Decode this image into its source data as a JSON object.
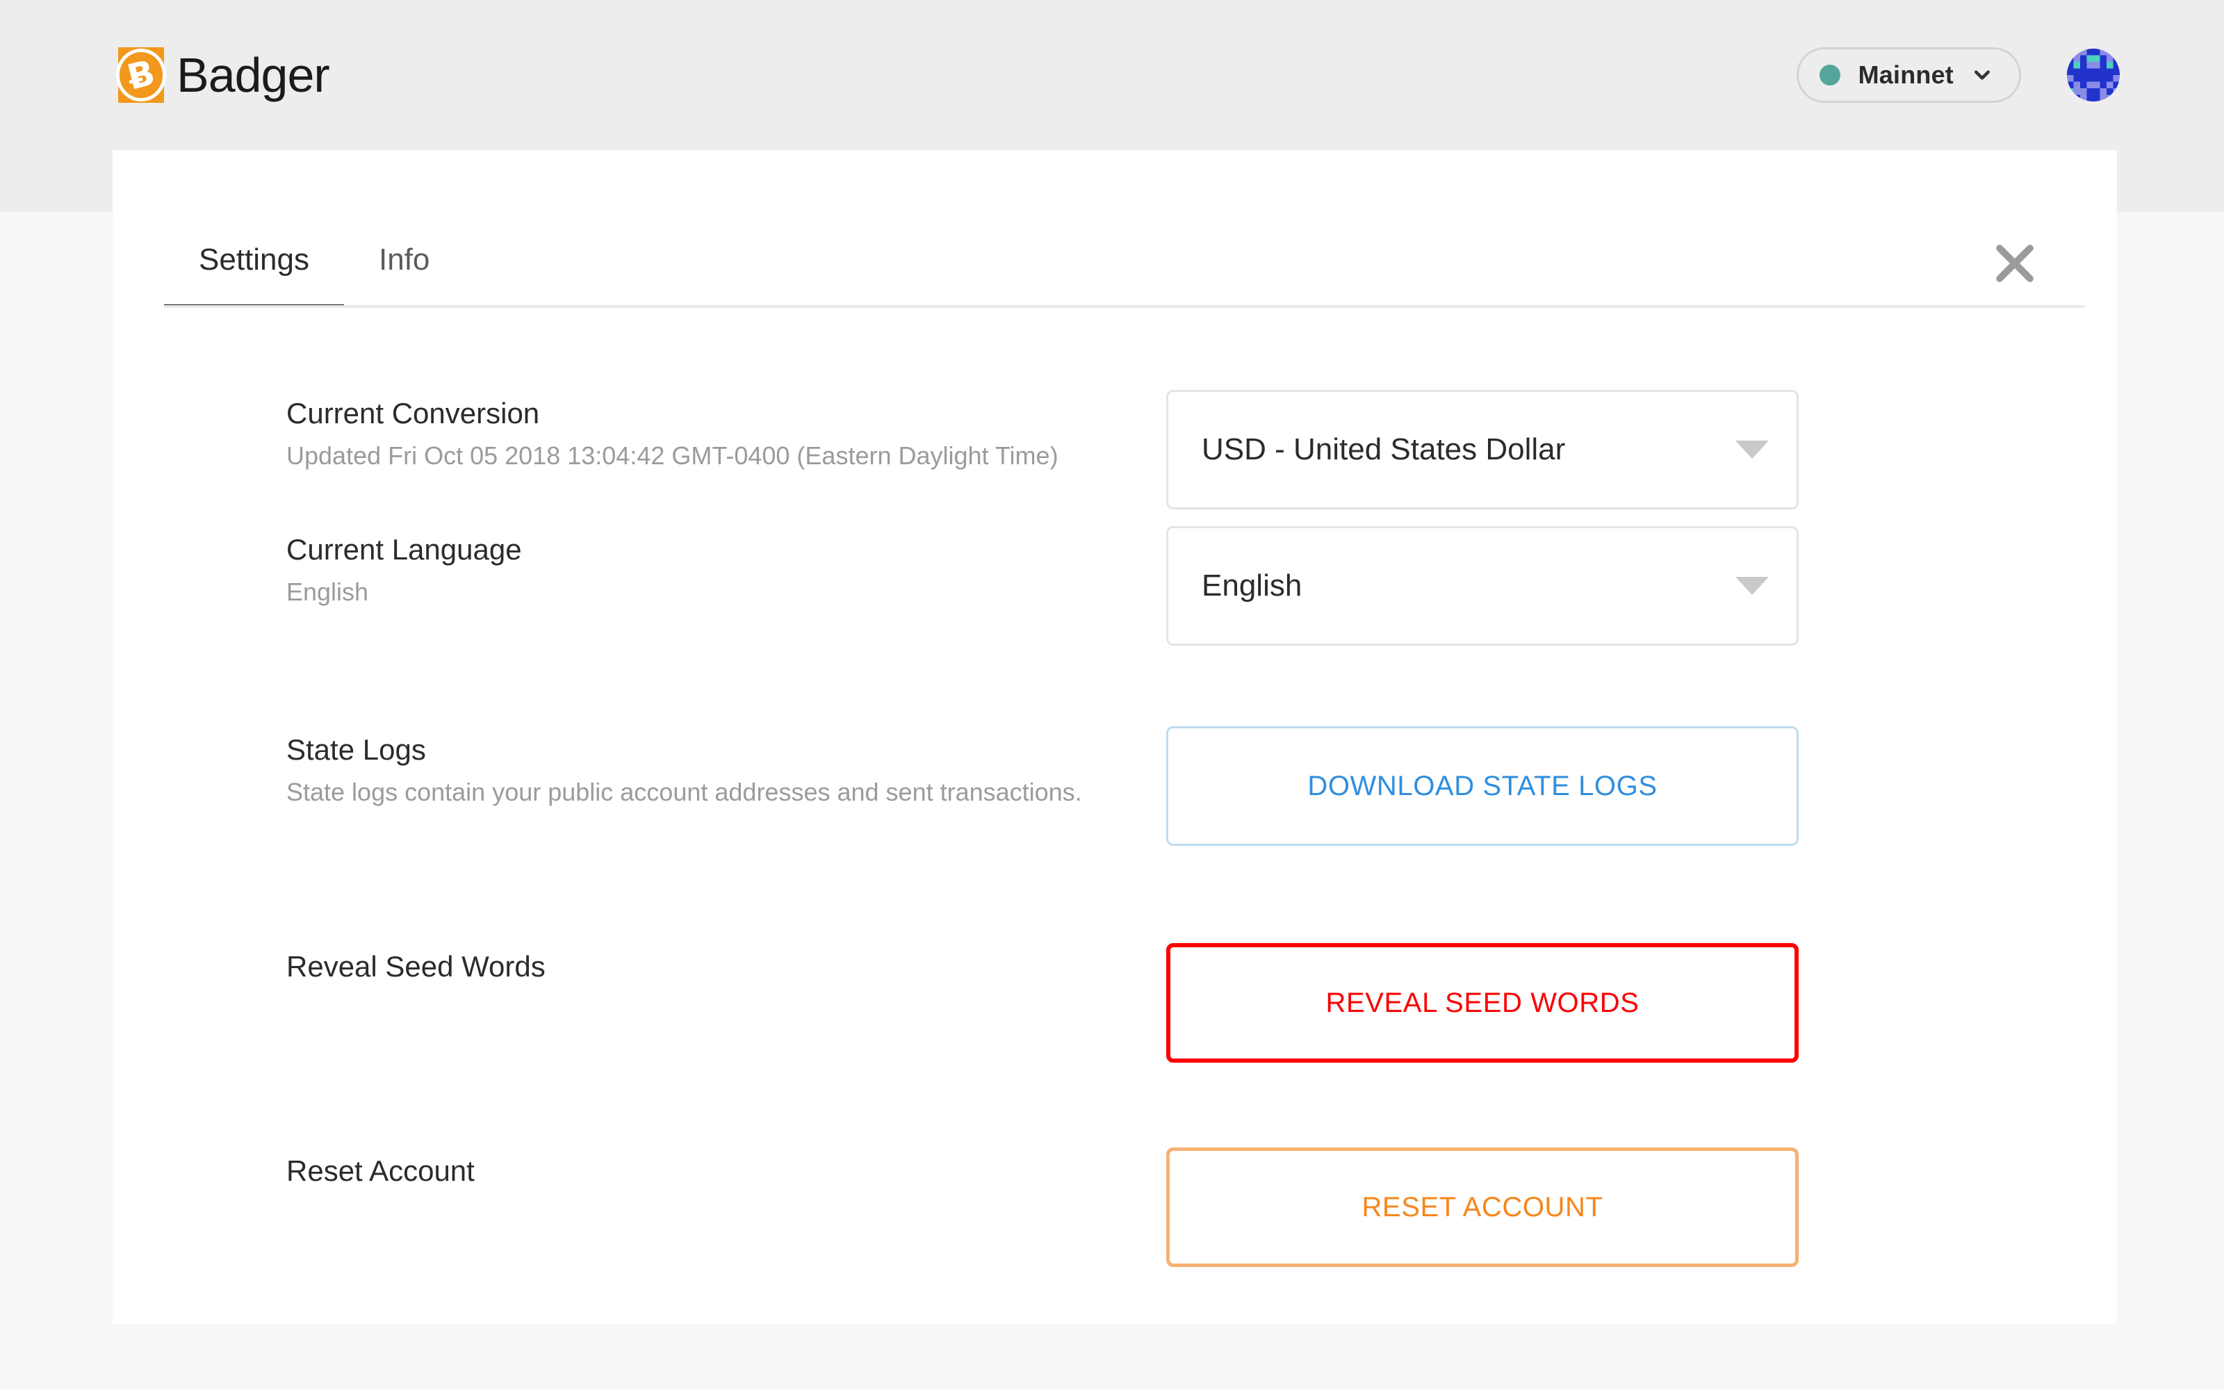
{
  "header": {
    "brand_name": "Badger",
    "brand_icon": "bitcoin-cash-logo-icon",
    "brand_symbol": "Ƀ",
    "network": {
      "label": "Mainnet",
      "status_color": "#54a59c",
      "chevron_icon": "chevron-down-icon"
    },
    "avatar_icon": "account-identicon-avatar"
  },
  "card": {
    "tabs": [
      {
        "label": "Settings",
        "active": true
      },
      {
        "label": "Info",
        "active": false
      }
    ],
    "close_icon": "close-icon",
    "rows": [
      {
        "title": "Current Conversion",
        "subtitle": "Updated Fri Oct 05 2018 13:04:42 GMT-0400 (Eastern Daylight Time)",
        "control": {
          "kind": "select",
          "value": "USD - United States Dollar",
          "caret_icon": "caret-down-icon"
        }
      },
      {
        "title": "Current Language",
        "subtitle": "English",
        "control": {
          "kind": "select",
          "value": "English",
          "caret_icon": "caret-down-icon"
        }
      },
      {
        "title": "State Logs",
        "subtitle": "State logs contain your public account addresses and sent transactions.",
        "control": {
          "kind": "button",
          "label": "DOWNLOAD STATE LOGS",
          "text_color": "#2f8edf",
          "border_color": "#bcdcf2"
        }
      },
      {
        "title": "Reveal Seed Words",
        "subtitle": "",
        "control": {
          "kind": "button",
          "label": "REVEAL SEED WORDS",
          "text_color": "#fb0000",
          "border_color": "#fb0000"
        }
      },
      {
        "title": "Reset Account",
        "subtitle": "",
        "control": {
          "kind": "button",
          "label": "RESET ACCOUNT",
          "text_color": "#f7861c",
          "border_color": "#f8b172"
        }
      }
    ]
  },
  "colors": {
    "brand_orange": "#f2981d",
    "page_background": "#f7f7f7",
    "header_background": "#ededed",
    "card_background": "#ffffff",
    "danger": "#fb0000",
    "warning": "#f7861c",
    "link": "#2f8edf"
  }
}
